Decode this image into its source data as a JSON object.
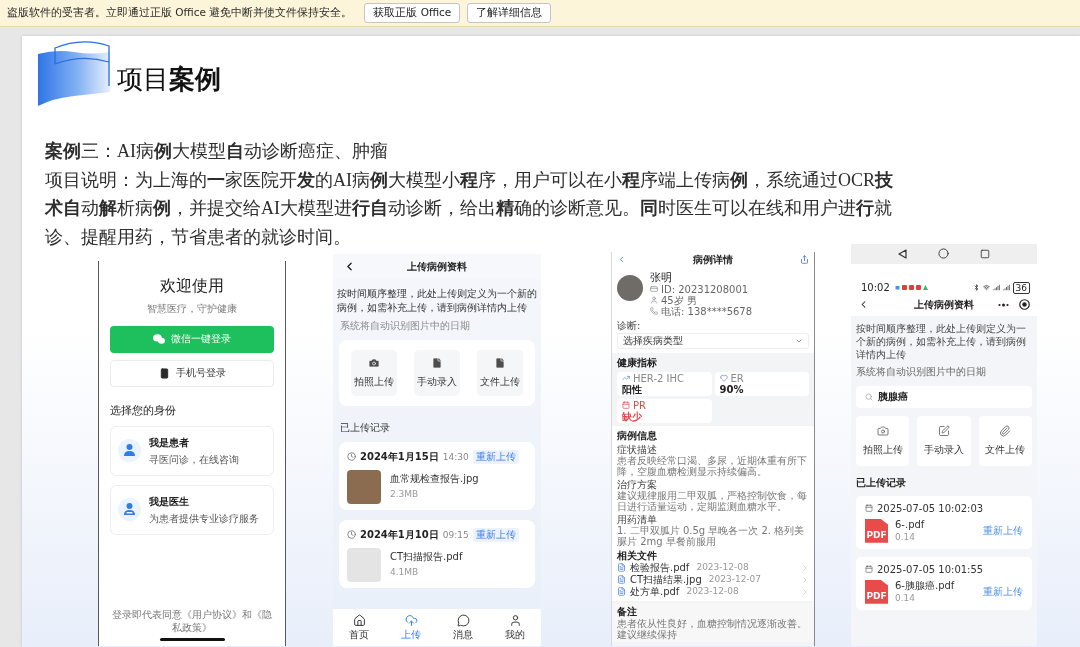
{
  "notification_bar": {
    "message": "盗版软件的受害者。立即通过正版 Office 避免中断并使文件保持安全。",
    "buttons": [
      {
        "label": "获取正版 Office"
      },
      {
        "label": "了解详细信息"
      }
    ]
  },
  "slide": {
    "title": "项目**案例**",
    "case_title": "**案例**三：AI病**例**大模型**自**动诊断癌症、肿瘤",
    "description": "项目说明：为上海的**一**家医院开**发**的AI病**例**大模型小**程**序，用户可以在小**程**序端上传病**例**，系统通过OCR**技术自**动**解**析病**例**，并提交给AI大模型进**行自**动诊断，给出**精**确的诊断意见。**同**时医生可以在线和用户进**行**就诊、提醒用药，节省患者的就诊时间。",
    "screenshots": [
      {
        "kind": "login",
        "heading": "欢迎使用",
        "tagline": "智慧医疗，守护健康",
        "wechat_button": "微信一键登录",
        "phone_button": "手机号登录",
        "identity_title": "选择您的身份",
        "identities": [
          {
            "title": "我是患者",
            "subtitle": "寻医问诊，在线咨询"
          },
          {
            "title": "我是医生",
            "subtitle": "为患者提供专业诊疗服务"
          }
        ],
        "agreement": "登录即代表同意《用户协议》和《隐私政策》"
      },
      {
        "kind": "upload",
        "title": "上传病例资料",
        "notice": "按时间顺序整理，此处上传则定义为一个新的病例，如需补充上传，请到病例详情内上传",
        "hint": "系统将自动识别图片中的日期",
        "actions": [
          {
            "label": "拍照上传"
          },
          {
            "label": "手动录入"
          },
          {
            "label": "文件上传"
          }
        ],
        "records_title": "已上传记录",
        "records": [
          {
            "date": "2024年1月15日",
            "time": "14:30",
            "action": "重新上传",
            "file": "血常规检查报告.jpg",
            "size": "2.3MB"
          },
          {
            "date": "2024年1月10日",
            "time": "09:15",
            "action": "重新上传",
            "file": "CT扫描报告.pdf",
            "size": "4.1MB"
          }
        ],
        "tabs": [
          {
            "label": "首页",
            "selected": false
          },
          {
            "label": "上传",
            "selected": true
          },
          {
            "label": "消息",
            "selected": false
          },
          {
            "label": "我的",
            "selected": false
          }
        ]
      },
      {
        "kind": "case_detail",
        "title": "病例详情",
        "patient": {
          "name": "张明",
          "id": "ID: 20231208001",
          "age_sex": "45岁 男",
          "phone": "电话: 138****5678"
        },
        "diagnosis": {
          "label": "诊断:",
          "placeholder": "选择疾病类型"
        },
        "metrics_title": "健康指标",
        "metrics": [
          {
            "name": "HER-2 IHC",
            "value": "阳性",
            "alert": false
          },
          {
            "name": "ER",
            "value": "90%",
            "alert": false
          },
          {
            "name": "PR",
            "value": "缺少",
            "alert": true
          }
        ],
        "info_title": "病例信息",
        "info_sections": [
          {
            "heading": "症状描述",
            "text": "患者反映经常口渴、多尿，近期体重有所下降，空腹血糖检测显示持续偏高。"
          },
          {
            "heading": "治疗方案",
            "text": "建议规律服用二甲双胍，严格控制饮食，每日进行适量运动，定期监测血糖水平。"
          },
          {
            "heading": "用药清单",
            "text": "1. 二甲双胍片 0.5g 早晚各一次 2. 格列美脲片 2mg 早餐前服用"
          }
        ],
        "files_title": "相关文件",
        "files": [
          {
            "name": "检验报告.pdf",
            "date": "2023-12-08"
          },
          {
            "name": "CT扫描结果.jpg",
            "date": "2023-12-07"
          },
          {
            "name": "处方单.pdf",
            "date": "2023-12-08"
          }
        ],
        "notes_title": "备注",
        "notes": "患者依从性良好，血糖控制情况逐渐改善。建议继续保持"
      },
      {
        "kind": "upload_search",
        "status": {
          "time": "10:02",
          "battery": "36"
        },
        "title": "上传病例资料",
        "notice": "按时间顺序整理，此处上传则定义为一个新的病例，如需补充上传，请到病例详情内上传",
        "hint": "系统将自动识别图片中的日期",
        "search": {
          "value": "胰腺癌"
        },
        "actions": [
          {
            "label": "拍照上传"
          },
          {
            "label": "手动录入"
          },
          {
            "label": "文件上传"
          }
        ],
        "records_title": "已上传记录",
        "records": [
          {
            "datetime": "2025-07-05 10:02:03",
            "file_type": "PDF",
            "file": "6-.pdf",
            "size": "0.14",
            "action": "重新上传"
          },
          {
            "datetime": "2025-07-05 10:01:55",
            "file_type": "PDF",
            "file": "6-胰腺癌.pdf",
            "size": "0.14",
            "action": "重新上传"
          }
        ]
      }
    ]
  }
}
